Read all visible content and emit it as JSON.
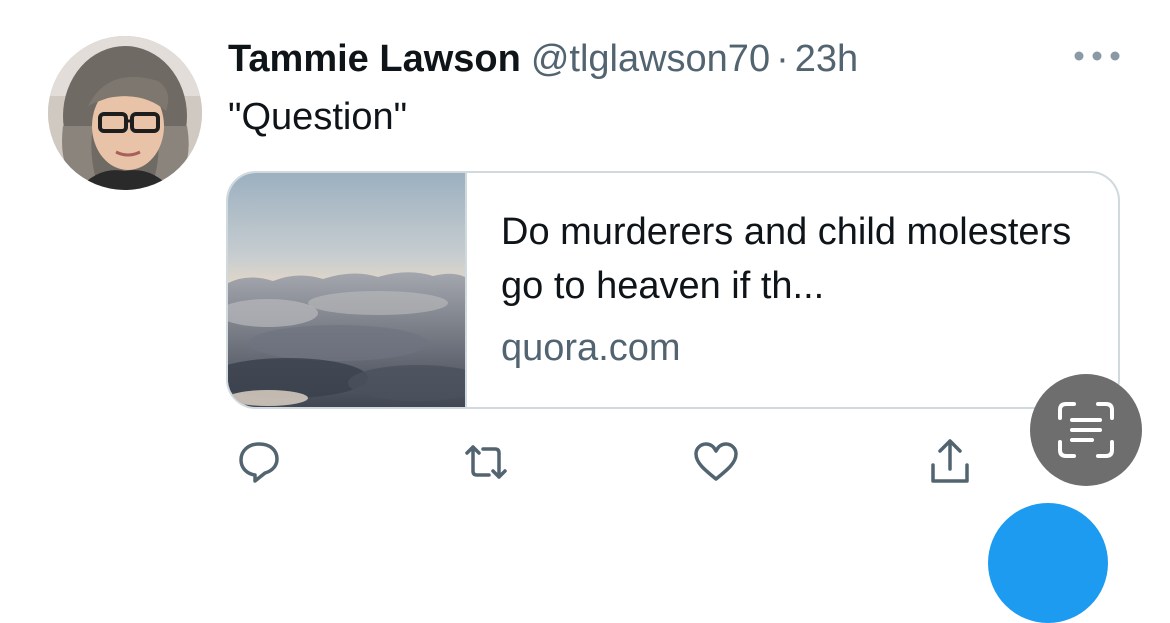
{
  "tweet": {
    "author": {
      "display_name": "Tammie Lawson",
      "handle": "@tlglawson70"
    },
    "separator": "·",
    "timestamp": "23h",
    "text": "\"Question\"",
    "card": {
      "title": "Do murderers and child molesters go to heaven if th...",
      "domain": "quora.com"
    },
    "actions": {
      "reply_icon": "reply-icon",
      "retweet_icon": "retweet-icon",
      "like_icon": "heart-icon",
      "share_icon": "share-icon"
    }
  },
  "overlay": {
    "scan_icon": "text-scan-icon"
  },
  "colors": {
    "primary_text": "#0f1419",
    "secondary_text": "#536471",
    "border": "#cfd9de",
    "accent": "#1d9bf0",
    "scan_button": "#6e6e6e"
  }
}
